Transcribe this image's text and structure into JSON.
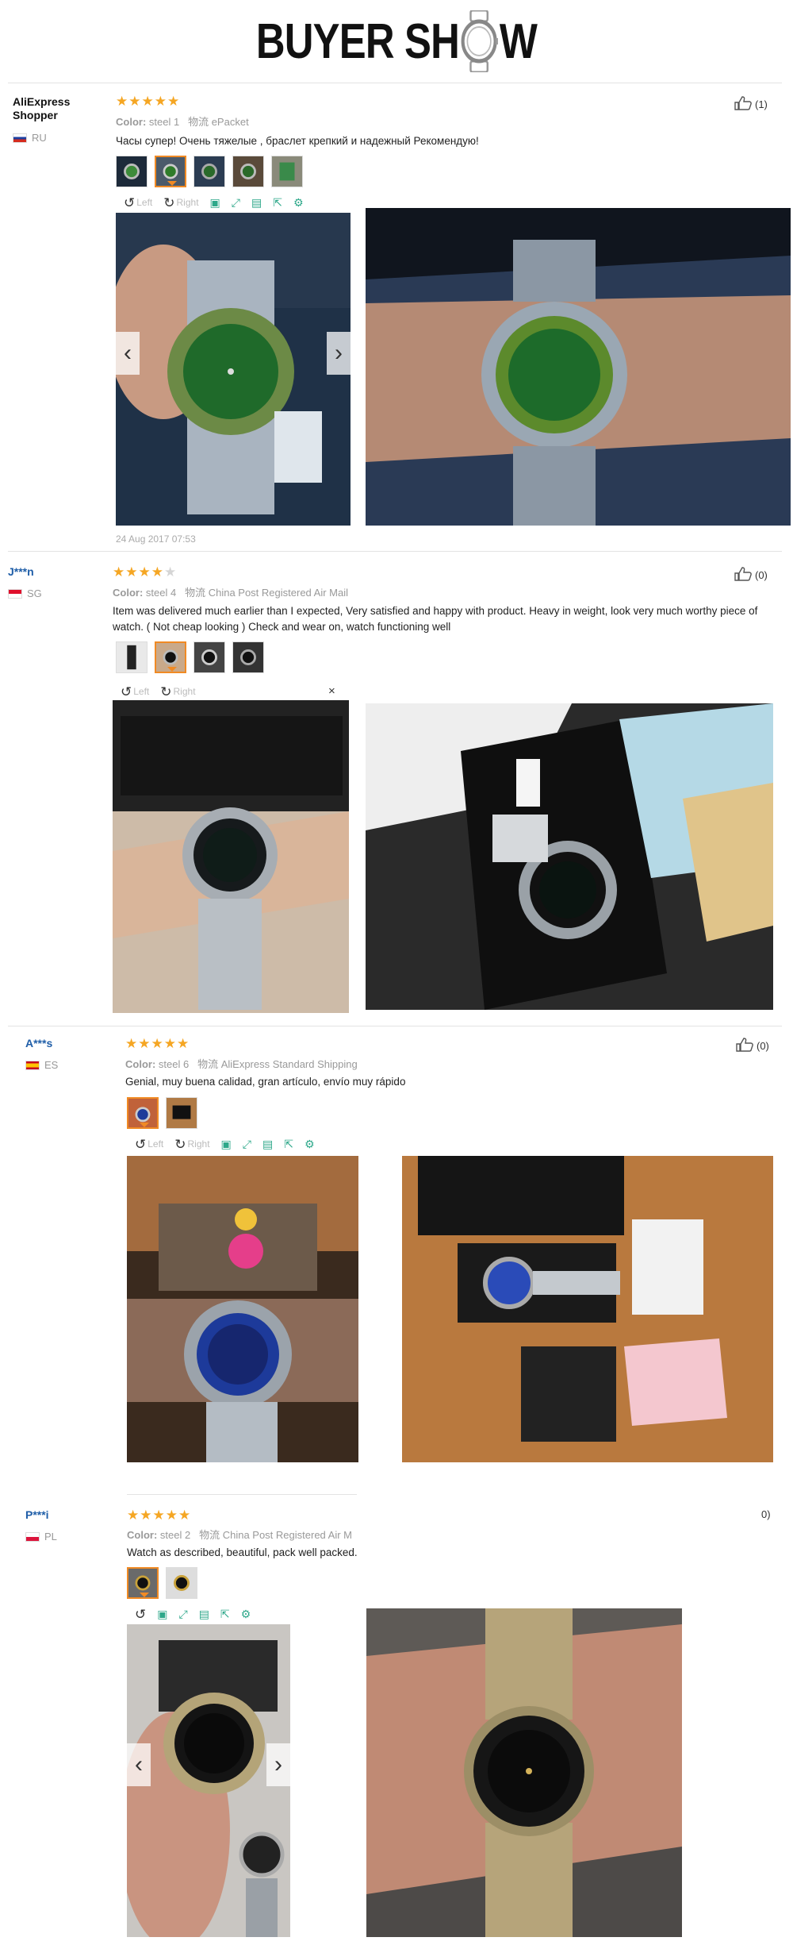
{
  "banner": {
    "part1": "BUYER SH",
    "part2": "W"
  },
  "reviews": [
    {
      "name": "AliExpress Shopper",
      "country": "RU",
      "stars": 5,
      "color_label": "Color:",
      "color_value": "steel 1",
      "ship_label": "物流",
      "ship_value": "ePacket",
      "comment": "Часы супер! Очень тяжелые , браслет крепкий и надежный Рекомендую!",
      "helpful": "(1)",
      "date": "24 Aug 2017 07:53",
      "rotate_left": "Left",
      "rotate_right": "Right"
    },
    {
      "name": "J***n",
      "country": "SG",
      "stars": 4,
      "color_label": "Color:",
      "color_value": "steel 4",
      "ship_label": "物流",
      "ship_value": "China Post Registered Air Mail",
      "comment": "Item was delivered much earlier than I expected, Very satisfied and happy with product. Heavy in weight, look very much worthy piece of watch. ( Not cheap looking ) Check and wear on, watch functioning well",
      "helpful": "(0)",
      "rotate_left": "Left",
      "rotate_right": "Right",
      "close": "×"
    },
    {
      "name": "A***s",
      "country": "ES",
      "stars": 5,
      "color_label": "Color:",
      "color_value": "steel 6",
      "ship_label": "物流",
      "ship_value": "AliExpress Standard Shipping",
      "comment": "Genial, muy buena calidad, gran artículo, envío muy rápido",
      "helpful": "(0)",
      "rotate_left": "Left",
      "rotate_right": "Right"
    },
    {
      "name": "P***i",
      "country": "PL",
      "stars": 5,
      "color_label": "Color:",
      "color_value": "steel 2",
      "ship_label": "物流",
      "ship_value": "China Post Registered Air M",
      "comment": "Watch as described, beautiful, pack well packed.",
      "helpful": "0)"
    }
  ],
  "colors": {
    "star": "#f5a623",
    "accent": "#f08a24",
    "link": "#1f5ea8",
    "tool_green": "#2ea88a"
  },
  "icons": [
    "thumbs-up-icon",
    "rotate-left-icon",
    "rotate-right-icon",
    "bookmark-icon",
    "expand-icon",
    "save-icon",
    "share-icon",
    "settings-icon",
    "chevron-left-icon",
    "chevron-right-icon",
    "close-icon"
  ]
}
